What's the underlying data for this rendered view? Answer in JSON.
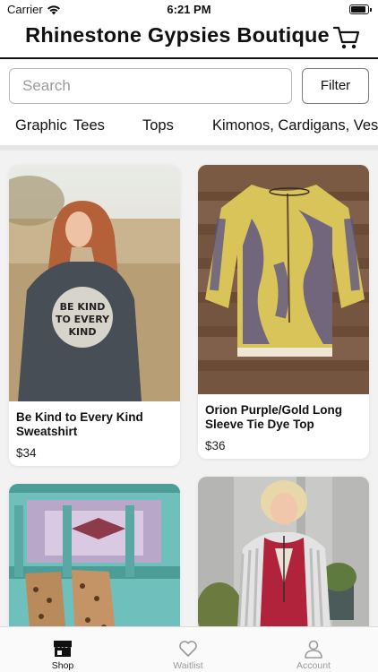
{
  "status_bar": {
    "carrier": "Carrier",
    "time": "6:21 PM",
    "battery_level": 0.95
  },
  "header": {
    "title": "Rhinestone Gypsies Boutique"
  },
  "search": {
    "placeholder": "Search",
    "filter_label": "Filter"
  },
  "categories": [
    "Graphic  Tees",
    "Tops",
    "Kimonos, Cardigans, Vests"
  ],
  "products": [
    {
      "name": "Be Kind to Every Kind Sweatshirt",
      "price": "$34",
      "graphic_text": "BE KIND TO EVERY KIND"
    },
    {
      "name": "Orion Purple/Gold Long Sleeve Tie Dye Top",
      "price": "$36"
    },
    {
      "name": "",
      "price": ""
    },
    {
      "name": "",
      "price": ""
    }
  ],
  "tab_bar": {
    "items": [
      {
        "label": "Shop",
        "icon": "store-icon",
        "active": true
      },
      {
        "label": "Waitlist",
        "icon": "heart-icon",
        "active": false
      },
      {
        "label": "Account",
        "icon": "person-icon",
        "active": false
      }
    ]
  },
  "colors": {
    "accent": "#111111",
    "inactive": "#9a9a9a",
    "background": "#ffffff",
    "grid_bg": "#f2f2f2"
  }
}
